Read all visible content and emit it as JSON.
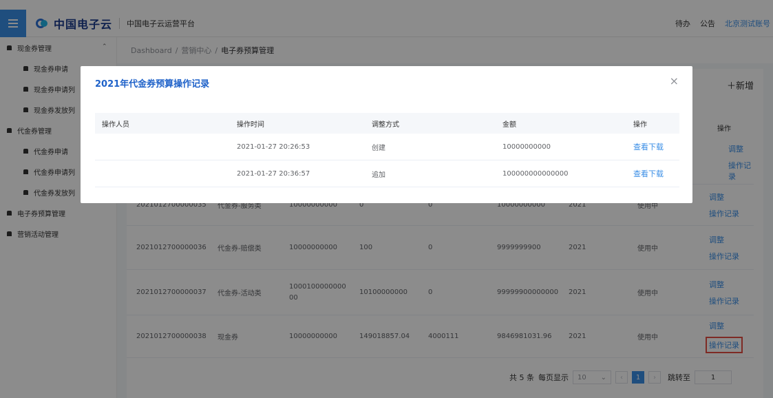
{
  "header": {
    "logo_text": "中国电子云",
    "platform": "中国电子云运营平台",
    "todo": "待办",
    "notice": "公告",
    "account": "北京测试账号"
  },
  "sidebar": {
    "items": [
      {
        "label": "现金券管理",
        "level": 1,
        "arrow": "⌃"
      },
      {
        "label": "现金券申请",
        "level": 2
      },
      {
        "label": "现金券申请列",
        "level": 2
      },
      {
        "label": "现金券发放列",
        "level": 2
      },
      {
        "label": "代金券管理",
        "level": 1
      },
      {
        "label": "代金券申请",
        "level": 2
      },
      {
        "label": "代金券申请列",
        "level": 2
      },
      {
        "label": "代金券发放列",
        "level": 2
      },
      {
        "label": "电子券预算管理",
        "level": 1
      },
      {
        "label": "营销活动管理",
        "level": 1
      }
    ]
  },
  "breadcrumb": {
    "items": [
      "Dashboard",
      "营销中心",
      "电子券预算管理"
    ],
    "sep": "/"
  },
  "main": {
    "add_label": "＋新增",
    "action_header": "操作",
    "action_adjust": "调整",
    "action_record": "操作记录",
    "rows": [
      {
        "id": "2021012700000035",
        "type": "代金券-服务类",
        "total": "10000000000",
        "used": "0",
        "frozen": "0",
        "remain": "10000000000",
        "year": "2021",
        "status": "使用中"
      },
      {
        "id": "2021012700000036",
        "type": "代金券-赔偿类",
        "total": "10000000000",
        "used": "100",
        "frozen": "0",
        "remain": "9999999900",
        "year": "2021",
        "status": "使用中"
      },
      {
        "id": "2021012700000037",
        "type": "代金券-活动类",
        "total": "100010000000000",
        "used": "10100000000",
        "frozen": "0",
        "remain": "99999900000000",
        "year": "2021",
        "status": "使用中"
      },
      {
        "id": "2021012700000038",
        "type": "现金券",
        "total": "10000000000",
        "used": "149018857.04",
        "frozen": "4000111",
        "remain": "9846981031.96",
        "year": "2021",
        "status": "使用中"
      }
    ]
  },
  "pager": {
    "total": "共 5 条",
    "per_page_label": "每页显示",
    "per_page_value": "10",
    "current_page": "1",
    "jump_label": "跳转至",
    "jump_value": "1"
  },
  "dialog": {
    "title": "2021年代金券预算操作记录",
    "close": "×",
    "columns": [
      "操作人员",
      "操作时间",
      "调整方式",
      "金额",
      "操作"
    ],
    "rows": [
      {
        "operator": "",
        "time": "2021-01-27 20:26:53",
        "method": "创建",
        "amount": "10000000000",
        "action": "查看下载"
      },
      {
        "operator": "",
        "time": "2021-01-27 20:36:57",
        "method": "追加",
        "amount": "100000000000000",
        "action": "查看下载"
      }
    ]
  }
}
